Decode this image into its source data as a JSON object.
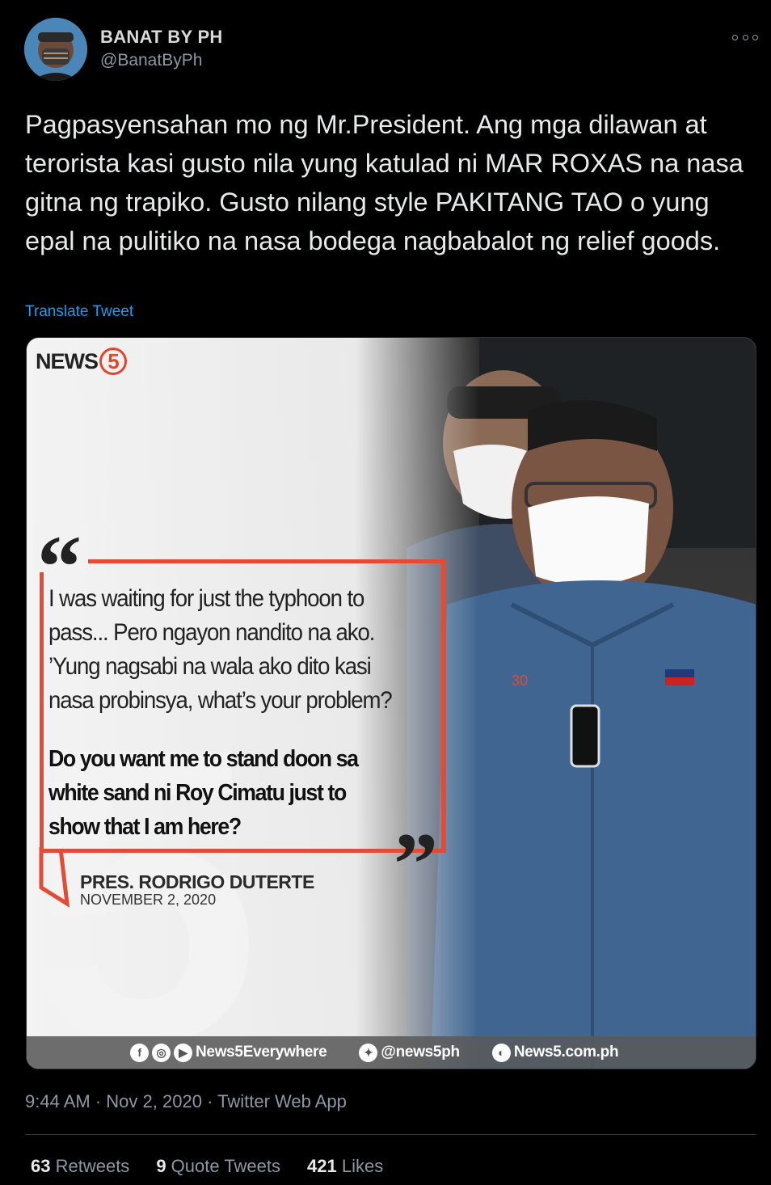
{
  "author": {
    "name": "BANAT BY PH",
    "handle": "@BanatByPh"
  },
  "tweet": {
    "text": "Pagpasyensahan mo ng Mr.President. Ang mga dilawan at terorista kasi gusto nila yung katulad ni MAR ROXAS na nasa gitna ng trapiko. Gusto nilang style PAKITANG TAO o yung epal na pulitiko na nasa bodega nagbabalot ng relief goods.",
    "translate_label": "Translate Tweet"
  },
  "media": {
    "logo_text": "NEWS",
    "logo_number": "5",
    "quote_open": "“",
    "quote_close": "”",
    "quote_lines": [
      "I was waiting for just the typhoon to",
      "pass... Pero ngayon nandito na ako.",
      "’Yung nagsabi na wala ako dito kasi",
      "nasa probinsya, what’s your problem?"
    ],
    "quote_bold_lines": [
      "Do you want me to stand doon sa",
      "white sand ni Roy Cimatu just to",
      "show that I am here?"
    ],
    "attribution_name": "PRES. RODRIGO DUTERTE",
    "attribution_date": "NOVEMBER 2, 2020",
    "footer": {
      "social_handle": "News5Everywhere",
      "twitter_handle": "@news5ph",
      "website": "News5.com.ph"
    },
    "accent_color": "#e24b35"
  },
  "meta": {
    "time": "9:44 AM",
    "date": "Nov 2, 2020",
    "source": "Twitter Web App",
    "separator": "·"
  },
  "stats": {
    "retweets_count": "63",
    "retweets_label": "Retweets",
    "quotes_count": "9",
    "quotes_label": "Quote Tweets",
    "likes_count": "421",
    "likes_label": "Likes"
  }
}
